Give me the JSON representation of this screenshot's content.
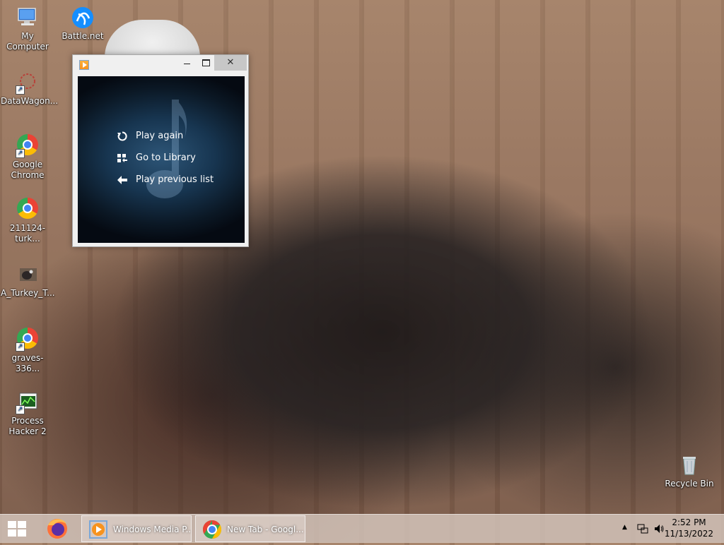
{
  "desktop": {
    "icons": [
      {
        "label": "My Computer"
      },
      {
        "label": "Battle.net"
      },
      {
        "label": "DataWagon..."
      },
      {
        "label": "Google Chrome"
      },
      {
        "label": "211124-turk..."
      },
      {
        "label": "A_Turkey_T..."
      },
      {
        "label": "graves-336..."
      },
      {
        "label": "Process Hacker 2"
      },
      {
        "label": "Recycle Bin"
      }
    ]
  },
  "wmp_window": {
    "menu": [
      {
        "label": "Play again",
        "icon": "replay-icon"
      },
      {
        "label": "Go to Library",
        "icon": "library-icon"
      },
      {
        "label": "Play previous list",
        "icon": "back-arrow-icon"
      }
    ]
  },
  "taskbar": {
    "tasks": [
      {
        "label": "Windows Media P...",
        "icon": "windows-media-player-icon"
      },
      {
        "label": "New Tab - Googl...",
        "icon": "chrome-icon"
      }
    ],
    "clock": {
      "time": "2:52 PM",
      "date": "11/13/2022"
    }
  },
  "colors": {
    "wmp_bg_center": "#2d5577",
    "wmp_bg_edge": "#050a12",
    "close_button": "#c7c7c7"
  }
}
